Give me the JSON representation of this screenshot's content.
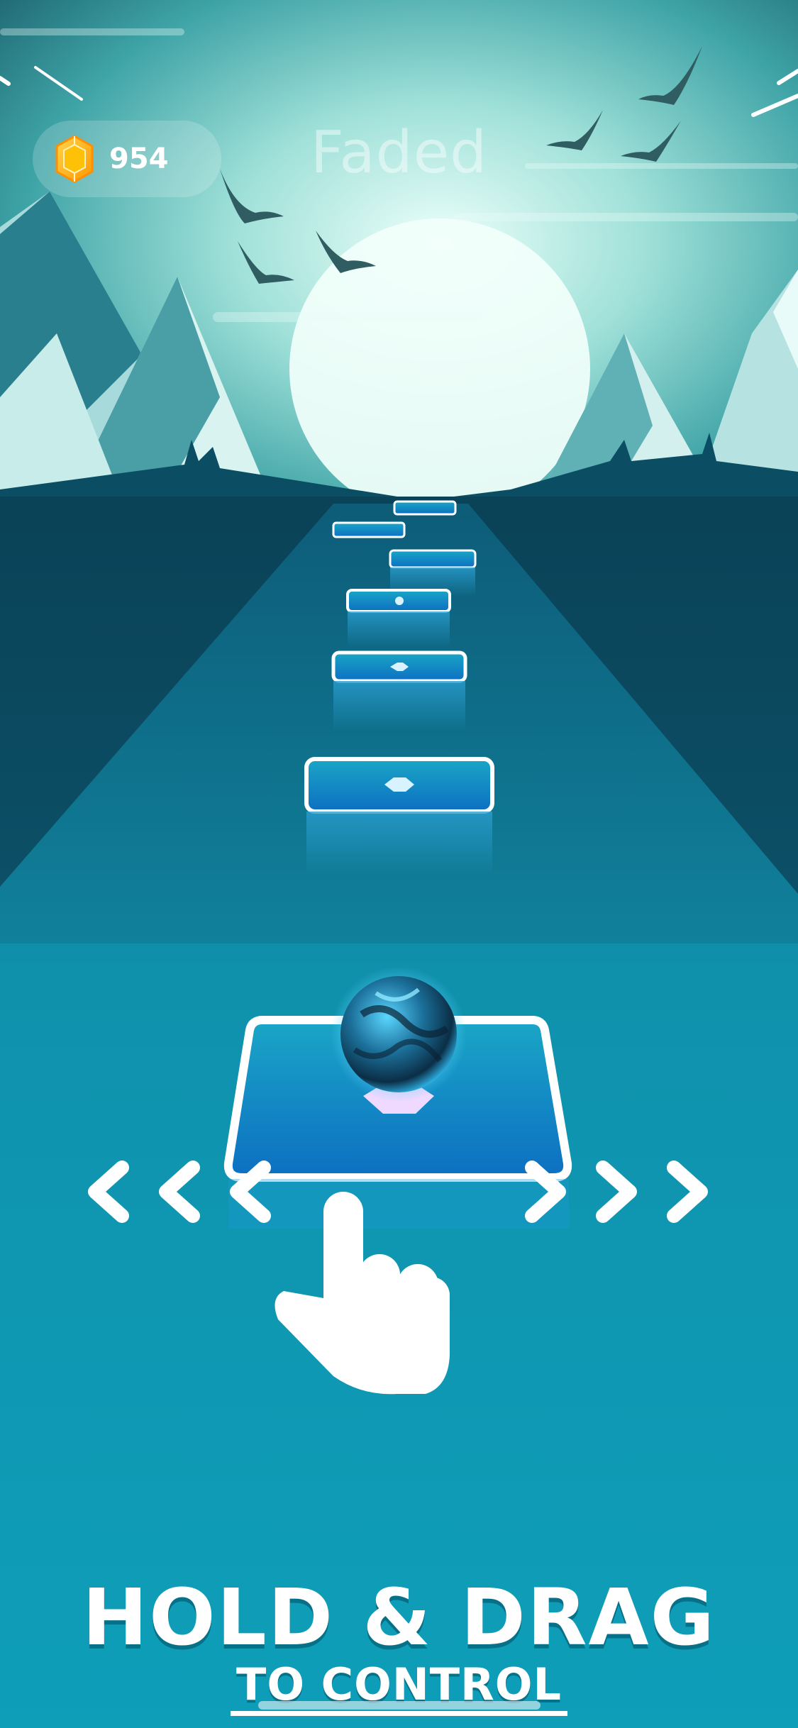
{
  "hud": {
    "gem_icon": "gem-icon",
    "gem_count": "954",
    "song_title": "Faded"
  },
  "tutorial": {
    "arrows_left_icon": "chevron-left-icon",
    "arrows_right_icon": "chevron-right-icon",
    "hand_icon": "pointing-hand-icon",
    "title": "HOLD & DRAG",
    "subtitle": "TO CONTROL"
  },
  "colors": {
    "sky_top": "#1e6f78",
    "sky_glow": "#d9f7f0",
    "mountain_dark": "#2b7f8c",
    "mountain_light": "#bfe6e6",
    "ground_dark": "#0b4a5e",
    "track": "#1494b0",
    "tile_blue": "#1178c3",
    "gem_orange": "#ffb300"
  }
}
